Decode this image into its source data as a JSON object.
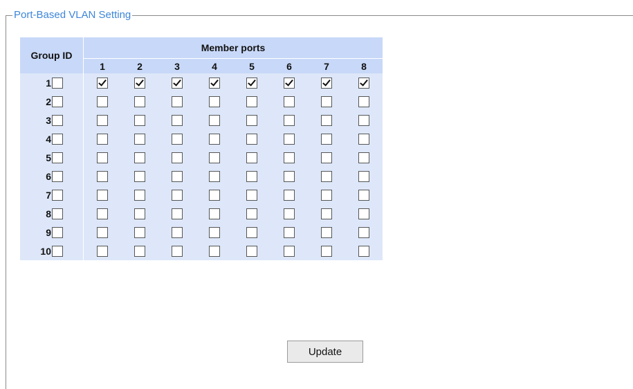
{
  "section": {
    "title": "Port-Based VLAN Setting"
  },
  "table": {
    "group_id_header": "Group ID",
    "member_ports_header": "Member ports",
    "ports": [
      "1",
      "2",
      "3",
      "4",
      "5",
      "6",
      "7",
      "8"
    ],
    "rows": [
      {
        "group": "1",
        "group_checked": false,
        "members": [
          true,
          true,
          true,
          true,
          true,
          true,
          true,
          true
        ]
      },
      {
        "group": "2",
        "group_checked": false,
        "members": [
          false,
          false,
          false,
          false,
          false,
          false,
          false,
          false
        ]
      },
      {
        "group": "3",
        "group_checked": false,
        "members": [
          false,
          false,
          false,
          false,
          false,
          false,
          false,
          false
        ]
      },
      {
        "group": "4",
        "group_checked": false,
        "members": [
          false,
          false,
          false,
          false,
          false,
          false,
          false,
          false
        ]
      },
      {
        "group": "5",
        "group_checked": false,
        "members": [
          false,
          false,
          false,
          false,
          false,
          false,
          false,
          false
        ]
      },
      {
        "group": "6",
        "group_checked": false,
        "members": [
          false,
          false,
          false,
          false,
          false,
          false,
          false,
          false
        ]
      },
      {
        "group": "7",
        "group_checked": false,
        "members": [
          false,
          false,
          false,
          false,
          false,
          false,
          false,
          false
        ]
      },
      {
        "group": "8",
        "group_checked": false,
        "members": [
          false,
          false,
          false,
          false,
          false,
          false,
          false,
          false
        ]
      },
      {
        "group": "9",
        "group_checked": false,
        "members": [
          false,
          false,
          false,
          false,
          false,
          false,
          false,
          false
        ]
      },
      {
        "group": "10",
        "group_checked": false,
        "members": [
          false,
          false,
          false,
          false,
          false,
          false,
          false,
          false
        ]
      }
    ]
  },
  "actions": {
    "update_label": "Update"
  }
}
